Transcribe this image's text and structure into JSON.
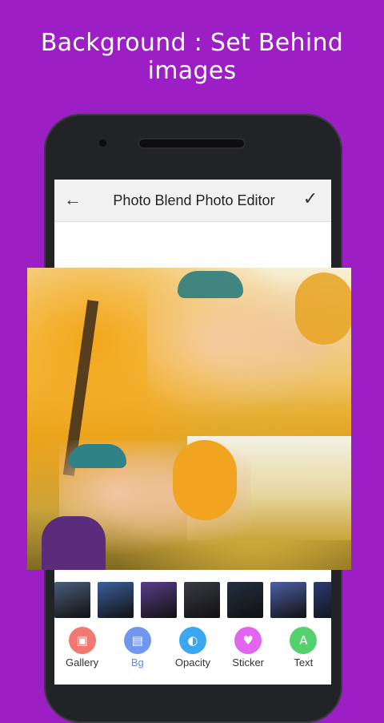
{
  "promo": {
    "title": "Background : Set Behind images"
  },
  "appbar": {
    "title": "Photo Blend Photo Editor",
    "back_icon": "arrow-left-icon",
    "confirm_icon": "check-icon"
  },
  "thumbnails": [
    {
      "name": "city-night-thumb",
      "color": "#4a5d7a"
    },
    {
      "name": "galaxy-swirl-thumb",
      "color": "#3b5f9c"
    },
    {
      "name": "eiffel-tower-thumb",
      "color": "#5a3d8a"
    },
    {
      "name": "skyline-thumb",
      "color": "#3a3b44"
    },
    {
      "name": "city-lights-thumb",
      "color": "#21303f"
    },
    {
      "name": "nebula-thumb",
      "color": "#4c5fa6"
    },
    {
      "name": "space-thumb",
      "color": "#2a3b72"
    }
  ],
  "toolbar": {
    "items": [
      {
        "label": "Gallery",
        "icon": "image-icon",
        "color": "#f07a72",
        "glyph": "▣",
        "active": false
      },
      {
        "label": "Bg",
        "icon": "background-icon",
        "color": "#6f97ef",
        "glyph": "▤",
        "active": true
      },
      {
        "label": "Opacity",
        "icon": "opacity-icon",
        "color": "#3aa7f1",
        "glyph": "◐",
        "active": false
      },
      {
        "label": "Sticker",
        "icon": "heart-icon",
        "color": "#e265ef",
        "glyph": "♥",
        "active": false
      },
      {
        "label": "Text",
        "icon": "text-icon",
        "color": "#54d06f",
        "glyph": "A",
        "active": false
      }
    ]
  }
}
